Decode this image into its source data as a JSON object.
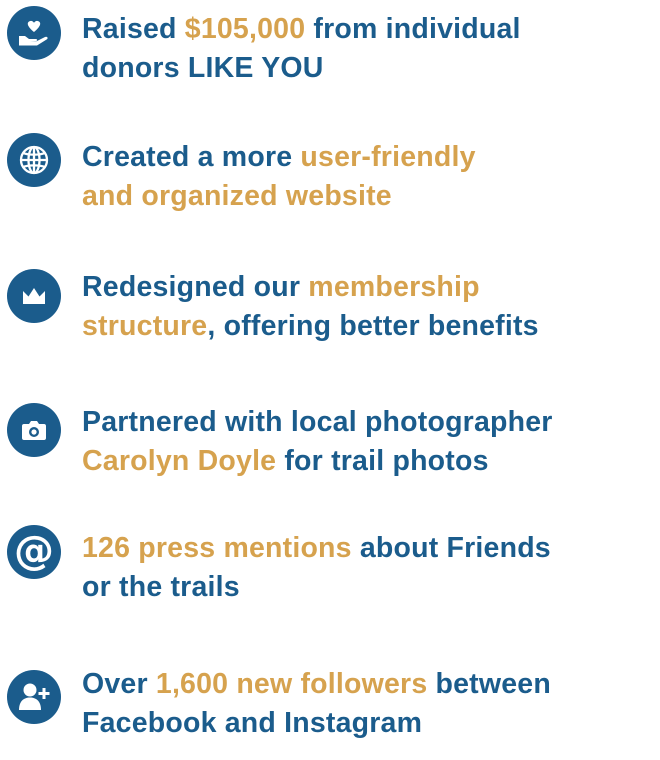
{
  "colors": {
    "primary": "#1b5c8c",
    "accent": "#d6a24e",
    "background": "#ffffff"
  },
  "items": [
    {
      "icon": "heart-hand-icon",
      "line1": {
        "a": "Raised ",
        "b": "$105,000",
        "c": " from individual"
      },
      "line2": {
        "a": "donors LIKE YOU",
        "b": "",
        "c": ""
      }
    },
    {
      "icon": "globe-icon",
      "line1": {
        "a": "Created a more ",
        "b": "user-friendly",
        "c": ""
      },
      "line2": {
        "a": "",
        "b": "and organized website",
        "c": ""
      }
    },
    {
      "icon": "crown-icon",
      "line1": {
        "a": "Redesigned our ",
        "b": "membership",
        "c": ""
      },
      "line2": {
        "a": "",
        "b": "structure",
        "c": ", offering better benefits"
      }
    },
    {
      "icon": "camera-icon",
      "line1": {
        "a": "Partnered with local photographer",
        "b": "",
        "c": ""
      },
      "line2": {
        "a": "",
        "b": "Carolyn Doyle",
        "c": " for trail photos"
      }
    },
    {
      "icon": "at-sign-icon",
      "line1": {
        "a": "",
        "b": "126 press mentions",
        "c": " about Friends"
      },
      "line2": {
        "a": "or the trails",
        "b": "",
        "c": ""
      }
    },
    {
      "icon": "add-user-icon",
      "line1": {
        "a": "Over ",
        "b": "1,600 new followers",
        "c": " between"
      },
      "line2": {
        "a": "Facebook and Instagram",
        "b": "",
        "c": ""
      }
    }
  ]
}
